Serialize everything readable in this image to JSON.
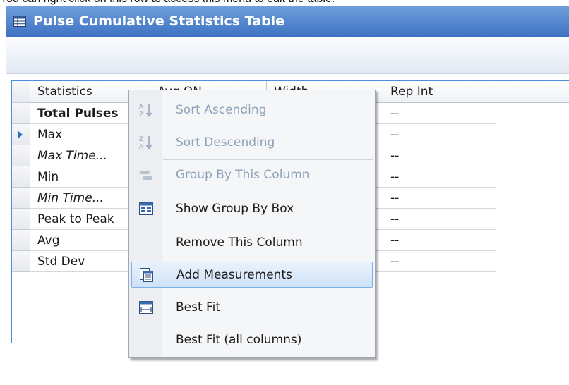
{
  "caption": "You can right click on this row to access this menu to edit the table.",
  "window": {
    "title": "Pulse Cumulative Statistics Table"
  },
  "table": {
    "columns": [
      "Statistics",
      "Avg ON",
      "Width",
      "Rep Int"
    ],
    "rows": [
      {
        "statistic": "Total Pulses",
        "style": "bold",
        "rep_int": "--"
      },
      {
        "statistic": "Max",
        "style": "normal",
        "rep_int": "--",
        "current": true
      },
      {
        "statistic": "Max Time...",
        "style": "italic",
        "rep_int": "--"
      },
      {
        "statistic": "Min",
        "style": "normal",
        "rep_int": "--"
      },
      {
        "statistic": "Min Time...",
        "style": "italic",
        "rep_int": "--"
      },
      {
        "statistic": "Peak to Peak",
        "style": "normal",
        "rep_int": "--"
      },
      {
        "statistic": "Avg",
        "style": "normal",
        "rep_int": "--"
      },
      {
        "statistic": "Std Dev",
        "style": "normal",
        "rep_int": "--"
      }
    ]
  },
  "context_menu": {
    "items": [
      {
        "label": "Sort Ascending",
        "icon": "sort-ascending-icon",
        "enabled": false
      },
      {
        "label": "Sort Descending",
        "icon": "sort-descending-icon",
        "enabled": false
      },
      {
        "label": "Group By This Column",
        "icon": "group-by-icon",
        "enabled": false
      },
      {
        "label": "Show Group By Box",
        "icon": "group-by-box-icon",
        "enabled": true
      },
      {
        "label": "Remove This Column",
        "icon": "",
        "enabled": true
      },
      {
        "label": "Add Measurements",
        "icon": "add-measurements-icon",
        "enabled": true,
        "highlighted": true
      },
      {
        "label": "Best Fit",
        "icon": "best-fit-icon",
        "enabled": true
      },
      {
        "label": "Best Fit (all columns)",
        "icon": "",
        "enabled": true
      }
    ]
  },
  "colors": {
    "titlebar": "#4a7fcc",
    "grid_border": "#4a8fd8",
    "menu_highlight": "#cfe2f8",
    "disabled_text": "#8ea2ba"
  }
}
